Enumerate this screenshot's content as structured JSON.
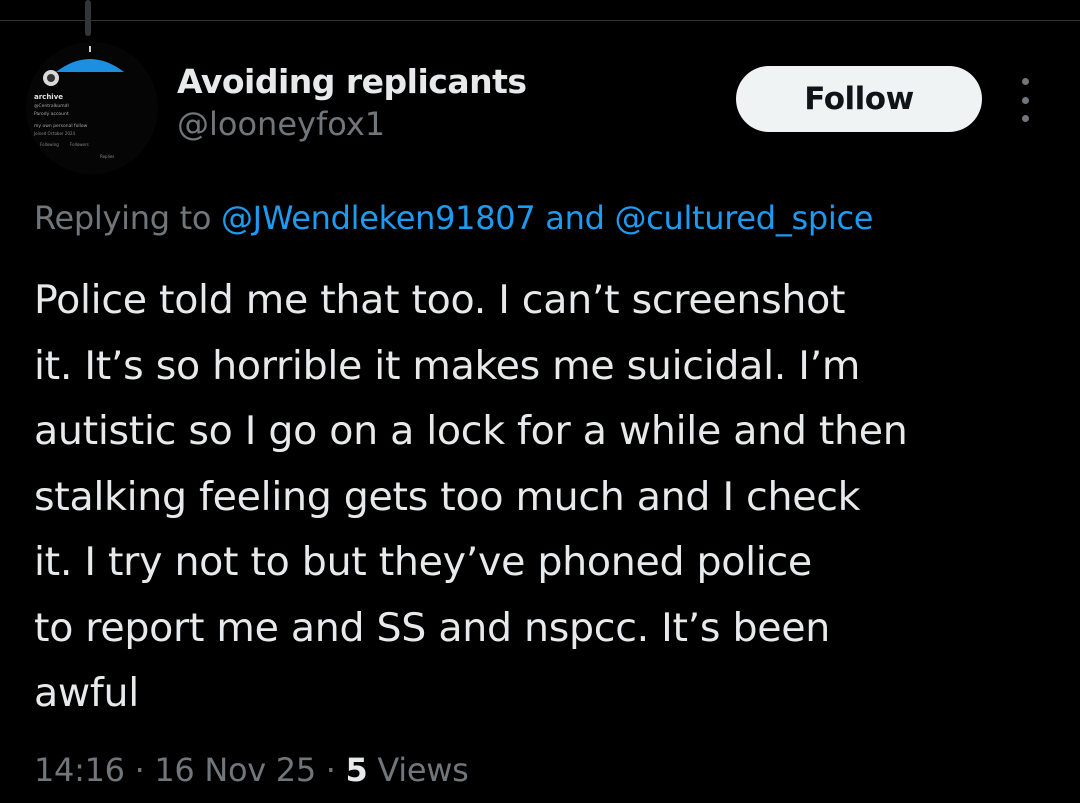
{
  "author": {
    "display_name": "Avoiding replicants",
    "handle": "@looneyfox1",
    "avatar_texts": [
      "archive",
      "@Centralkumdl",
      "Parody account",
      "my own personal follow",
      "Joined October 2024",
      "Following",
      "Followers",
      "Replies"
    ]
  },
  "actions": {
    "follow_label": "Follow",
    "more_icon": "more-vertical-icon"
  },
  "reply": {
    "prefix": "Replying to",
    "mention_1": "@JWendleken91807",
    "conjunction": "and",
    "mention_2": "@cultured_spice"
  },
  "tweet": {
    "text": "Police told me that too.  I can’t screenshot\nit.  It’s so horrible it makes me suicidal.  I’m\nautistic so I go on a lock for a while and then\nstalking feeling gets too much and I check\nit.  I try not to but they’ve phoned police\nto report me and SS and nspcc.  It’s been\nawful"
  },
  "meta": {
    "time": "14:16",
    "separator_1": " · ",
    "date": "16 Nov 25",
    "separator_2": " · ",
    "views_count": "5",
    "views_label": "Views"
  },
  "colors": {
    "background": "#000000",
    "text_primary": "#e7e9ea",
    "text_secondary": "#71767b",
    "link": "#1d9bf0",
    "follow_bg": "#eff3f4",
    "avatar_accent": "#1d8fe0"
  }
}
